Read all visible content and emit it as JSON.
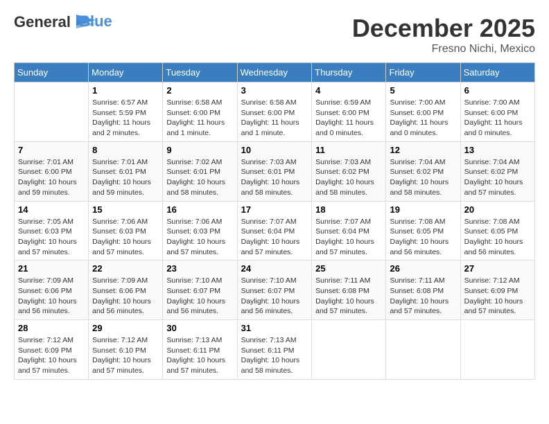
{
  "header": {
    "logo_line1": "General",
    "logo_line2": "Blue",
    "month": "December 2025",
    "location": "Fresno Nichi, Mexico"
  },
  "weekdays": [
    "Sunday",
    "Monday",
    "Tuesday",
    "Wednesday",
    "Thursday",
    "Friday",
    "Saturday"
  ],
  "weeks": [
    [
      {
        "day": "",
        "info": ""
      },
      {
        "day": "1",
        "info": "Sunrise: 6:57 AM\nSunset: 5:59 PM\nDaylight: 11 hours\nand 2 minutes."
      },
      {
        "day": "2",
        "info": "Sunrise: 6:58 AM\nSunset: 6:00 PM\nDaylight: 11 hours\nand 1 minute."
      },
      {
        "day": "3",
        "info": "Sunrise: 6:58 AM\nSunset: 6:00 PM\nDaylight: 11 hours\nand 1 minute."
      },
      {
        "day": "4",
        "info": "Sunrise: 6:59 AM\nSunset: 6:00 PM\nDaylight: 11 hours\nand 0 minutes."
      },
      {
        "day": "5",
        "info": "Sunrise: 7:00 AM\nSunset: 6:00 PM\nDaylight: 11 hours\nand 0 minutes."
      },
      {
        "day": "6",
        "info": "Sunrise: 7:00 AM\nSunset: 6:00 PM\nDaylight: 11 hours\nand 0 minutes."
      }
    ],
    [
      {
        "day": "7",
        "info": "Sunrise: 7:01 AM\nSunset: 6:00 PM\nDaylight: 10 hours\nand 59 minutes."
      },
      {
        "day": "8",
        "info": "Sunrise: 7:01 AM\nSunset: 6:01 PM\nDaylight: 10 hours\nand 59 minutes."
      },
      {
        "day": "9",
        "info": "Sunrise: 7:02 AM\nSunset: 6:01 PM\nDaylight: 10 hours\nand 58 minutes."
      },
      {
        "day": "10",
        "info": "Sunrise: 7:03 AM\nSunset: 6:01 PM\nDaylight: 10 hours\nand 58 minutes."
      },
      {
        "day": "11",
        "info": "Sunrise: 7:03 AM\nSunset: 6:02 PM\nDaylight: 10 hours\nand 58 minutes."
      },
      {
        "day": "12",
        "info": "Sunrise: 7:04 AM\nSunset: 6:02 PM\nDaylight: 10 hours\nand 58 minutes."
      },
      {
        "day": "13",
        "info": "Sunrise: 7:04 AM\nSunset: 6:02 PM\nDaylight: 10 hours\nand 57 minutes."
      }
    ],
    [
      {
        "day": "14",
        "info": "Sunrise: 7:05 AM\nSunset: 6:03 PM\nDaylight: 10 hours\nand 57 minutes."
      },
      {
        "day": "15",
        "info": "Sunrise: 7:06 AM\nSunset: 6:03 PM\nDaylight: 10 hours\nand 57 minutes."
      },
      {
        "day": "16",
        "info": "Sunrise: 7:06 AM\nSunset: 6:03 PM\nDaylight: 10 hours\nand 57 minutes."
      },
      {
        "day": "17",
        "info": "Sunrise: 7:07 AM\nSunset: 6:04 PM\nDaylight: 10 hours\nand 57 minutes."
      },
      {
        "day": "18",
        "info": "Sunrise: 7:07 AM\nSunset: 6:04 PM\nDaylight: 10 hours\nand 57 minutes."
      },
      {
        "day": "19",
        "info": "Sunrise: 7:08 AM\nSunset: 6:05 PM\nDaylight: 10 hours\nand 56 minutes."
      },
      {
        "day": "20",
        "info": "Sunrise: 7:08 AM\nSunset: 6:05 PM\nDaylight: 10 hours\nand 56 minutes."
      }
    ],
    [
      {
        "day": "21",
        "info": "Sunrise: 7:09 AM\nSunset: 6:06 PM\nDaylight: 10 hours\nand 56 minutes."
      },
      {
        "day": "22",
        "info": "Sunrise: 7:09 AM\nSunset: 6:06 PM\nDaylight: 10 hours\nand 56 minutes."
      },
      {
        "day": "23",
        "info": "Sunrise: 7:10 AM\nSunset: 6:07 PM\nDaylight: 10 hours\nand 56 minutes."
      },
      {
        "day": "24",
        "info": "Sunrise: 7:10 AM\nSunset: 6:07 PM\nDaylight: 10 hours\nand 56 minutes."
      },
      {
        "day": "25",
        "info": "Sunrise: 7:11 AM\nSunset: 6:08 PM\nDaylight: 10 hours\nand 57 minutes."
      },
      {
        "day": "26",
        "info": "Sunrise: 7:11 AM\nSunset: 6:08 PM\nDaylight: 10 hours\nand 57 minutes."
      },
      {
        "day": "27",
        "info": "Sunrise: 7:12 AM\nSunset: 6:09 PM\nDaylight: 10 hours\nand 57 minutes."
      }
    ],
    [
      {
        "day": "28",
        "info": "Sunrise: 7:12 AM\nSunset: 6:09 PM\nDaylight: 10 hours\nand 57 minutes."
      },
      {
        "day": "29",
        "info": "Sunrise: 7:12 AM\nSunset: 6:10 PM\nDaylight: 10 hours\nand 57 minutes."
      },
      {
        "day": "30",
        "info": "Sunrise: 7:13 AM\nSunset: 6:11 PM\nDaylight: 10 hours\nand 57 minutes."
      },
      {
        "day": "31",
        "info": "Sunrise: 7:13 AM\nSunset: 6:11 PM\nDaylight: 10 hours\nand 58 minutes."
      },
      {
        "day": "",
        "info": ""
      },
      {
        "day": "",
        "info": ""
      },
      {
        "day": "",
        "info": ""
      }
    ]
  ]
}
